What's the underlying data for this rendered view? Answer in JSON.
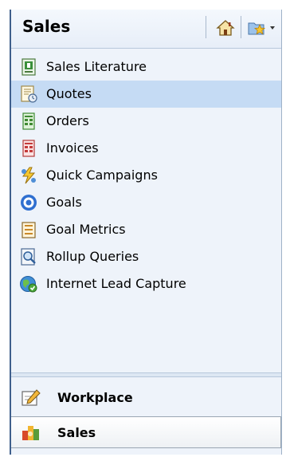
{
  "header": {
    "title": "Sales",
    "home_icon": "home-icon",
    "favorites_icon": "favorites-folder-icon"
  },
  "sitemap": {
    "selected_index": 1,
    "items": [
      {
        "label": "Sales Literature",
        "icon": "sales-literature-icon"
      },
      {
        "label": "Quotes",
        "icon": "quotes-icon"
      },
      {
        "label": "Orders",
        "icon": "orders-icon"
      },
      {
        "label": "Invoices",
        "icon": "invoices-icon"
      },
      {
        "label": "Quick Campaigns",
        "icon": "quick-campaigns-icon"
      },
      {
        "label": "Goals",
        "icon": "goals-icon"
      },
      {
        "label": "Goal Metrics",
        "icon": "goal-metrics-icon"
      },
      {
        "label": "Rollup Queries",
        "icon": "rollup-queries-icon"
      },
      {
        "label": "Internet Lead Capture",
        "icon": "internet-lead-capture-icon"
      }
    ]
  },
  "areas": [
    {
      "label": "Workplace",
      "icon": "workplace-icon",
      "active": false
    },
    {
      "label": "Sales",
      "icon": "sales-icon",
      "active": true
    }
  ],
  "colors": {
    "selected_row": "#c5dbf4",
    "panel_bg": "#eef3fa",
    "panel_border": "#3f5f8c"
  }
}
